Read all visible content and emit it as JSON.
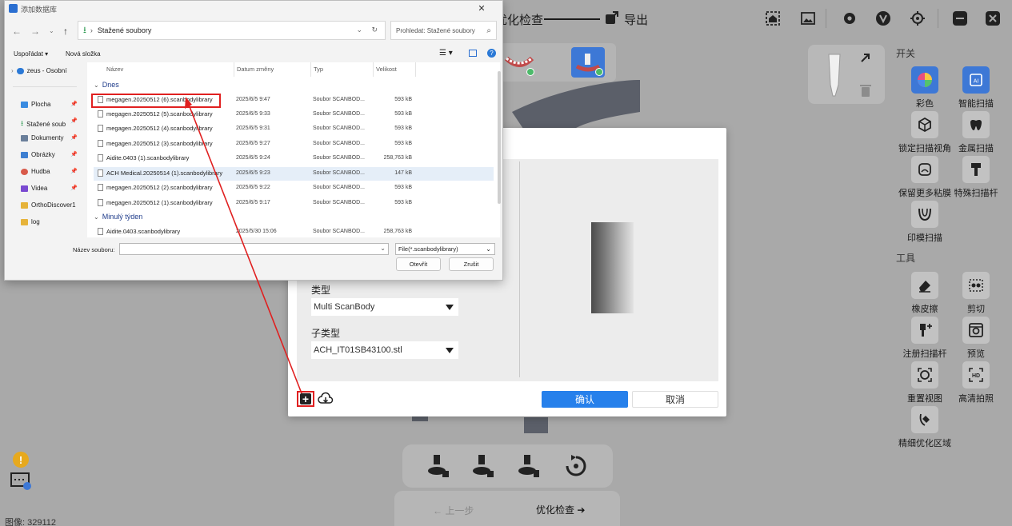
{
  "app": {
    "workflow_text": "优化检查",
    "export_label": "导出",
    "switch_section": "开关",
    "tools_section": "工具",
    "switch_tools": [
      {
        "label": "彩色",
        "icon": "color-wheel-icon"
      },
      {
        "label": "智能扫描",
        "icon": "ai-chip-icon"
      },
      {
        "label": "锁定扫描视角",
        "icon": "cube-lock-icon"
      },
      {
        "label": "金属扫描",
        "icon": "metal-tooth-icon"
      },
      {
        "label": "保留更多粘膜",
        "icon": "mucosa-icon"
      },
      {
        "label": "特殊扫描杆",
        "icon": "scan-rod-icon"
      },
      {
        "label": "印模扫描",
        "icon": "impression-icon"
      }
    ],
    "tools": [
      {
        "label": "橡皮擦",
        "icon": "eraser-icon"
      },
      {
        "label": "剪切",
        "icon": "cut-icon"
      },
      {
        "label": "注册扫描杆",
        "icon": "register-rod-icon"
      },
      {
        "label": "预览",
        "icon": "preview-icon"
      },
      {
        "label": "重置视图",
        "icon": "reset-view-icon"
      },
      {
        "label": "高清拍照",
        "icon": "hd-photo-icon"
      },
      {
        "label": "精细优化区域",
        "icon": "refine-area-icon"
      }
    ],
    "nav_prev": "上一步",
    "nav_next": "优化检查",
    "status": "图像: 329112",
    "warning": "!"
  },
  "lib_dialog": {
    "type_label": "类型",
    "type_value": "Multi ScanBody",
    "subtype_label": "子类型",
    "subtype_value": "ACH_IT01SB43100.stl",
    "confirm": "确认",
    "cancel": "取消",
    "add_symbol": "+"
  },
  "file_dialog": {
    "title": "添加数据库",
    "address": "Stažené soubory",
    "search_placeholder": "Prohledat: Stažené soubory",
    "organize": "Uspořádat",
    "new_folder": "Nová složka",
    "nav_items": [
      {
        "label": "zeus - Osobní",
        "color": "#2b79d6"
      },
      {
        "label": "Plocha",
        "color": "#3a8be0"
      },
      {
        "label": "Stažené soub",
        "color": "#2e9b52"
      },
      {
        "label": "Dokumenty",
        "color": "#6a7f9a"
      },
      {
        "label": "Obrázky",
        "color": "#3d7fd1"
      },
      {
        "label": "Hudba",
        "color": "#d85a4a"
      },
      {
        "label": "Videa",
        "color": "#7a4ad1"
      },
      {
        "label": "OrthoDiscover1",
        "color": "#e6b33a"
      },
      {
        "label": "log",
        "color": "#e6b33a"
      }
    ],
    "columns": [
      "Název",
      "Datum změny",
      "Typ",
      "Velikost"
    ],
    "group_today": "Dnes",
    "group_lastweek": "Minulý týden",
    "files_today": [
      {
        "name": "megagen.20250512 (6).scanbodylibrary",
        "date": "2025/6/5 9:47",
        "type": "Soubor SCANBOD...",
        "size": "593 kB"
      },
      {
        "name": "megagen.20250512 (5).scanbodylibrary",
        "date": "2025/6/5 9:33",
        "type": "Soubor SCANBOD...",
        "size": "593 kB"
      },
      {
        "name": "megagen.20250512 (4).scanbodylibrary",
        "date": "2025/6/5 9:31",
        "type": "Soubor SCANBOD...",
        "size": "593 kB"
      },
      {
        "name": "megagen.20250512 (3).scanbodylibrary",
        "date": "2025/6/5 9:27",
        "type": "Soubor SCANBOD...",
        "size": "593 kB"
      },
      {
        "name": "Aidite.0403 (1).scanbodylibrary",
        "date": "2025/6/5 9:24",
        "type": "Soubor SCANBOD...",
        "size": "258,763 kB"
      },
      {
        "name": "ACH Medical.20250514 (1).scanbodylibrary",
        "date": "2025/6/5 9:23",
        "type": "Soubor SCANBOD...",
        "size": "147 kB"
      },
      {
        "name": "megagen.20250512 (2).scanbodylibrary",
        "date": "2025/6/5 9:22",
        "type": "Soubor SCANBOD...",
        "size": "593 kB"
      },
      {
        "name": "megagen.20250512 (1).scanbodylibrary",
        "date": "2025/6/5 9:17",
        "type": "Soubor SCANBOD...",
        "size": "593 kB"
      }
    ],
    "files_lastweek": [
      {
        "name": "Aidite.0403.scanbodylibrary",
        "date": "2025/5/30 15:06",
        "type": "Soubor SCANBOD...",
        "size": "258,763 kB"
      }
    ],
    "filename_label": "Název souboru:",
    "filetype": "File(*.scanbodylibrary)",
    "open": "Otevřít",
    "cancel": "Zrušit"
  },
  "colors": {
    "accent": "#2680eb",
    "highlight": "#e02020"
  }
}
